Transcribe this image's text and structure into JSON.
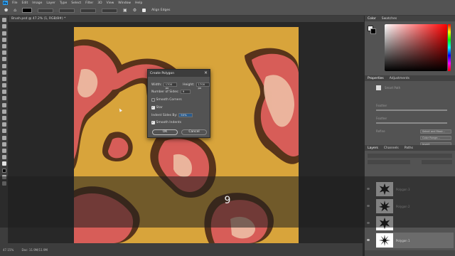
{
  "menubar": {
    "logo": "Ps",
    "items": [
      "File",
      "Edit",
      "Image",
      "Layer",
      "Type",
      "Select",
      "Filter",
      "3D",
      "View",
      "Window",
      "Help"
    ]
  },
  "optionsbar": {
    "align_edges_label": "Align Edges"
  },
  "document": {
    "tab_title": "Brush.psd @ 47.2% (1, RGB/8#) *",
    "zoom": "47.15%",
    "doc_info": "Doc: 11.9M/11.9M"
  },
  "overlay": {
    "number": "9"
  },
  "colors_panel": {
    "tabs": [
      "Color",
      "Swatches"
    ]
  },
  "properties_panel": {
    "tabs": [
      "Properties",
      "Adjustments"
    ],
    "section": "Smart Path",
    "labels": [
      "Feather",
      "Feather",
      "Refine"
    ],
    "buttons": [
      "Select and Mask...",
      "Color Range...",
      "Invert"
    ]
  },
  "layers_panel": {
    "tabs": [
      "Layers",
      "Channels",
      "Paths"
    ],
    "layers": [
      {
        "name": "Polygon 3",
        "selected": false
      },
      {
        "name": "Polygon 2",
        "selected": false
      },
      {
        "name": "",
        "selected": false
      },
      {
        "name": "Polygon 1",
        "selected": true
      }
    ]
  },
  "dialog": {
    "title": "Create Polygon",
    "close_glyph": "×",
    "width_label": "Width:",
    "width_value": "1700 px",
    "height_label": "Height:",
    "height_value": "1700 px",
    "sides_label": "Number of Sides:",
    "sides_value": "9",
    "smooth_corners_label": "Smooth Corners",
    "star_label": "Star",
    "indent_label": "Indent Sides By:",
    "indent_value": "50%",
    "smooth_indents_label": "Smooth Indents",
    "ok_label": "OK",
    "cancel_label": "Cancel",
    "smooth_corners_checked": false,
    "star_checked": true,
    "smooth_indents_checked": true
  },
  "colors": {
    "ui_dark": "#282828",
    "ui_panel": "#535353",
    "art_base": "#d9a53c",
    "art_pink": "#d8545d",
    "art_dark": "#3a1a14"
  }
}
